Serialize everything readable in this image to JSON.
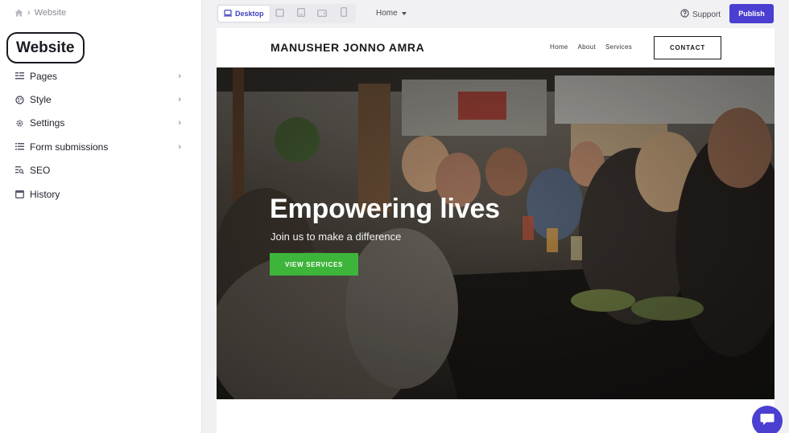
{
  "breadcrumb": {
    "current": "Website"
  },
  "sidebar": {
    "title": "Website",
    "items": [
      {
        "label": "Pages",
        "icon": "pages-icon",
        "has_arrow": true
      },
      {
        "label": "Style",
        "icon": "style-icon",
        "has_arrow": true
      },
      {
        "label": "Settings",
        "icon": "gear-icon",
        "has_arrow": true
      },
      {
        "label": "Form submissions",
        "icon": "list-icon",
        "has_arrow": true
      },
      {
        "label": "SEO",
        "icon": "seo-icon",
        "has_arrow": false
      },
      {
        "label": "History",
        "icon": "calendar-icon",
        "has_arrow": false
      }
    ]
  },
  "toolbar": {
    "device_active": "Desktop",
    "page_select": "Home",
    "support": "Support",
    "publish": "Publish"
  },
  "site": {
    "brand": "MANUSHER JONNO AMRA",
    "nav": [
      "Home",
      "About",
      "Services"
    ],
    "contact": "CONTACT",
    "hero_title": "Empowering lives",
    "hero_subtitle": "Join us to make a difference",
    "hero_button": "VIEW SERVICES"
  },
  "colors": {
    "accent": "#4a3fd0",
    "hero_button": "#3db53a"
  }
}
